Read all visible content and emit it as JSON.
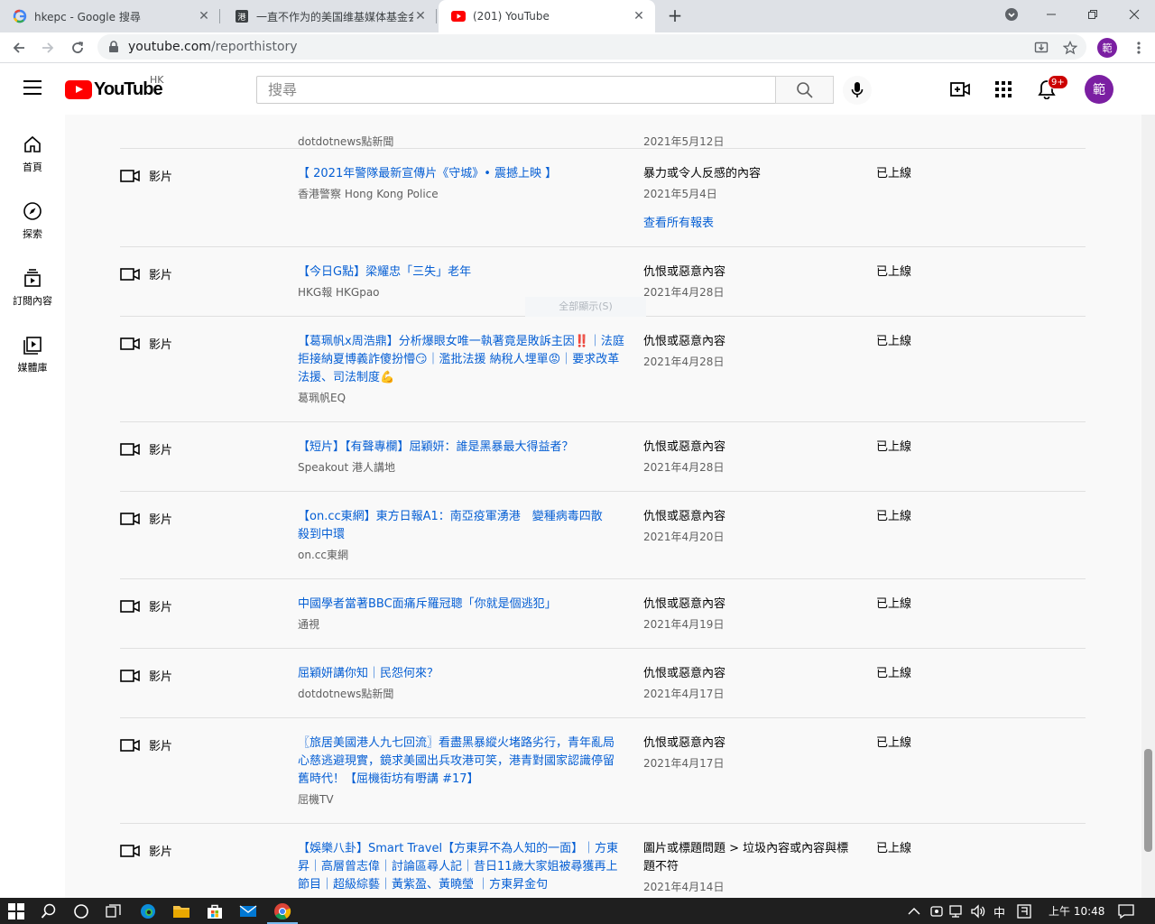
{
  "browser": {
    "tabs": [
      {
        "title": "hkepc - Google 搜尋",
        "icon": "google-icon"
      },
      {
        "title": "一直不作为的美国维基媒体基金会",
        "icon": "site-icon"
      },
      {
        "title": "(201) YouTube",
        "icon": "youtube-icon"
      }
    ],
    "url_host": "youtube.com",
    "url_path": "/reporthistory",
    "profile_initial": "範"
  },
  "masthead": {
    "country_code": "HK",
    "search_placeholder": "搜尋",
    "notification_count": "9+",
    "avatar_initial": "範"
  },
  "guide": {
    "items": [
      {
        "label": "首頁",
        "icon": "home-icon"
      },
      {
        "label": "探索",
        "icon": "compass-icon"
      },
      {
        "label": "訂閱內容",
        "icon": "subscriptions-icon"
      },
      {
        "label": "媒體庫",
        "icon": "library-icon"
      }
    ]
  },
  "content": {
    "ghost_hint": "全部顯示(S)",
    "rows": [
      {
        "type": "影片",
        "title": "",
        "channel": "dotdotnews點新聞",
        "reason": "",
        "date": "2021年5月12日",
        "link": "",
        "status": ""
      },
      {
        "type": "影片",
        "title": "【 2021年警隊最新宣傳片《守城》• 震撼上映 】",
        "channel": "香港警察 Hong Kong Police",
        "reason": "暴力或令人反感的內容",
        "date": "2021年5月4日",
        "link": "查看所有報表",
        "status": "已上線"
      },
      {
        "type": "影片",
        "title": "【今日G點】梁耀忠「三失」老年",
        "channel": "HKG報 HKGpao",
        "reason": "仇恨或惡意內容",
        "date": "2021年4月28日",
        "link": "",
        "status": "已上線"
      },
      {
        "type": "影片",
        "title": "【葛珮帆x周浩鼎】分析爆眼女唯一執著竟是敗訴主因‼️｜法庭拒接納夏博義詐傻扮懵😏｜濫批法援 納稅人埋單😡｜要求改革法援、司法制度💪",
        "channel": "葛珮帆EQ",
        "reason": "仇恨或惡意內容",
        "date": "2021年4月28日",
        "link": "",
        "status": "已上線"
      },
      {
        "type": "影片",
        "title": "【短片】【有聲專欄】屈穎妍：誰是黑暴最大得益者？",
        "channel": "Speakout 港人講地",
        "reason": "仇恨或惡意內容",
        "date": "2021年4月28日",
        "link": "",
        "status": "已上線"
      },
      {
        "type": "影片",
        "title": "【on.cc東網】東方日報A1：南亞疫軍湧港　變種病毒四散　殺到中環",
        "channel": "on.cc東網",
        "reason": "仇恨或惡意內容",
        "date": "2021年4月20日",
        "link": "",
        "status": "已上線"
      },
      {
        "type": "影片",
        "title": "中國學者當著BBC面痛斥羅冠聰「你就是個逃犯」",
        "channel": "通視",
        "reason": "仇恨或惡意內容",
        "date": "2021年4月19日",
        "link": "",
        "status": "已上線"
      },
      {
        "type": "影片",
        "title": "屈穎妍講你知｜民怨何來？",
        "channel": "dotdotnews點新聞",
        "reason": "仇恨或惡意內容",
        "date": "2021年4月17日",
        "link": "",
        "status": "已上線"
      },
      {
        "type": "影片",
        "title": "〖旅居美國港人九七回流〗看盡黑暴縱火堵路劣行，青年亂局心慈逃避現實，鏡求美國出兵攻港可笑，港青對國家認識停留舊時代！【屈機街坊有嘢講 #17】",
        "channel": "屈機TV",
        "reason": "仇恨或惡意內容",
        "date": "2021年4月17日",
        "link": "",
        "status": "已上線"
      },
      {
        "type": "影片",
        "title": "【娛樂八卦】Smart Travel【方東昇不為人知的一面】｜方東昇｜高層曾志偉｜討論區尋人記｜昔日11歲大家姐被尋獲再上節目｜超級綜藝｜黃紫盈、黃曉瑩 ｜方東昇金句",
        "channel": "",
        "reason": "圖片或標題問題 > 垃圾內容或內容與標題不符",
        "date": "2021年4月14日",
        "link": "",
        "status": "已上線"
      }
    ]
  },
  "taskbar": {
    "ime": "中",
    "time": "上午 10:48"
  }
}
